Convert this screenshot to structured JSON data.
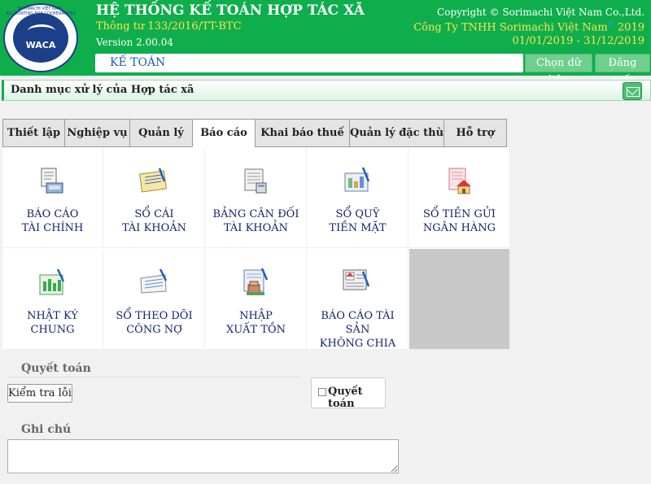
{
  "header": {
    "logo_text": "WACA",
    "logo_ring_text": "SORIMACHI VIỆT NAM · ACCOUNTING FOR COOPERATIVES",
    "title": "HỆ THỐNG KẾ TOÁN HỢP TÁC XÃ",
    "circular": "Thông tư 133/2016/TT-BTC",
    "version": "Version 2.00.04",
    "copyright": "Copyright © Sorimachi Việt Nam Co.,Ltd.",
    "company": "Công Ty TNHH Sorimachi Việt Nam",
    "company_mark": "®",
    "company_year": "2019",
    "period": "01/01/2019 - 31/12/2019",
    "module": "KẾ TOÁN",
    "select_data_label": "Chọn dữ liệu",
    "logout_label": "Đăng xuất"
  },
  "section": {
    "title": "Danh mục xử lý của Hợp tác xã",
    "mail_icon": "mail-icon"
  },
  "tabs": [
    {
      "label": "Thiết lập",
      "active": false
    },
    {
      "label": "Nghiệp vụ",
      "active": false
    },
    {
      "label": "Quản lý",
      "active": false
    },
    {
      "label": "Báo cáo",
      "active": true
    },
    {
      "label": "Khai báo thuế",
      "active": false
    },
    {
      "label": "Quản lý đặc thù",
      "active": false
    },
    {
      "label": "Hỗ trợ",
      "active": false
    }
  ],
  "reports": [
    {
      "line1": "BÁO CÁO",
      "line2": "TÀI CHÍNH",
      "icon": "financial-report-icon"
    },
    {
      "line1": "SỔ CÁI",
      "line2": "TÀI KHOẢN",
      "icon": "ledger-icon"
    },
    {
      "line1": "BẢNG CÂN ĐỐI",
      "line2": "TÀI KHOẢN",
      "icon": "balance-sheet-icon"
    },
    {
      "line1": "SỔ QUỸ",
      "line2": "TIỀN MẶT",
      "icon": "cash-book-icon"
    },
    {
      "line1": "SỔ TIỀN GỬI",
      "line2": "NGÂN HÀNG",
      "icon": "bank-deposit-icon"
    },
    {
      "line1": "NHẬT KÝ",
      "line2": "CHUNG",
      "icon": "journal-icon"
    },
    {
      "line1": "SỔ THEO DÕI",
      "line2": "CÔNG NỢ",
      "icon": "debt-tracking-icon"
    },
    {
      "line1": "NHẬP",
      "line2": "XUẤT TỒN",
      "icon": "inventory-icon"
    },
    {
      "line1": "BÁO CÁO TÀI SẢN",
      "line2": "KHÔNG CHIA",
      "icon": "asset-report-icon"
    }
  ],
  "settlement": {
    "section_label": "Quyết toán",
    "check_errors_label": "Kiểm tra lỗi",
    "checkbox_label": "Quyết toán",
    "checked": false
  },
  "notes": {
    "label": "Ghi chú",
    "value": ""
  },
  "colors": {
    "header_green": "#0fae4c",
    "title_yellow": "#ffe34d",
    "label_navy": "#12246e",
    "module_blue": "#1b5fbd"
  }
}
